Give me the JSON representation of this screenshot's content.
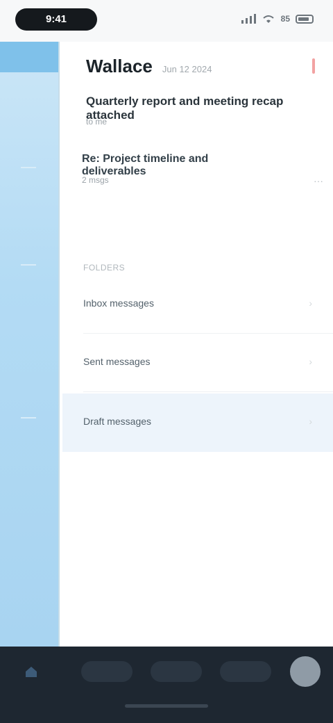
{
  "status_bar": {
    "time": "9:41",
    "battery": "85"
  },
  "mail": {
    "sender": "Wallace",
    "date": "Jun 12 2024",
    "subject": "Quarterly report and meeting recap attached",
    "to": "to me"
  },
  "thread": {
    "title": "Re: Project timeline and deliverables",
    "meta": "2 msgs",
    "more": "···"
  },
  "list": {
    "section_label": "FOLDERS",
    "rows": [
      {
        "label": "Inbox messages",
        "chevron": "›"
      },
      {
        "label": "Sent messages",
        "chevron": "›"
      },
      {
        "label": "Draft messages",
        "chevron": "›"
      }
    ]
  },
  "colors": {
    "accent": "#7fc1ea",
    "sidebar": "#b3dbf4",
    "bottom_bar": "#1e2731",
    "selected_row": "#edf4fb"
  }
}
